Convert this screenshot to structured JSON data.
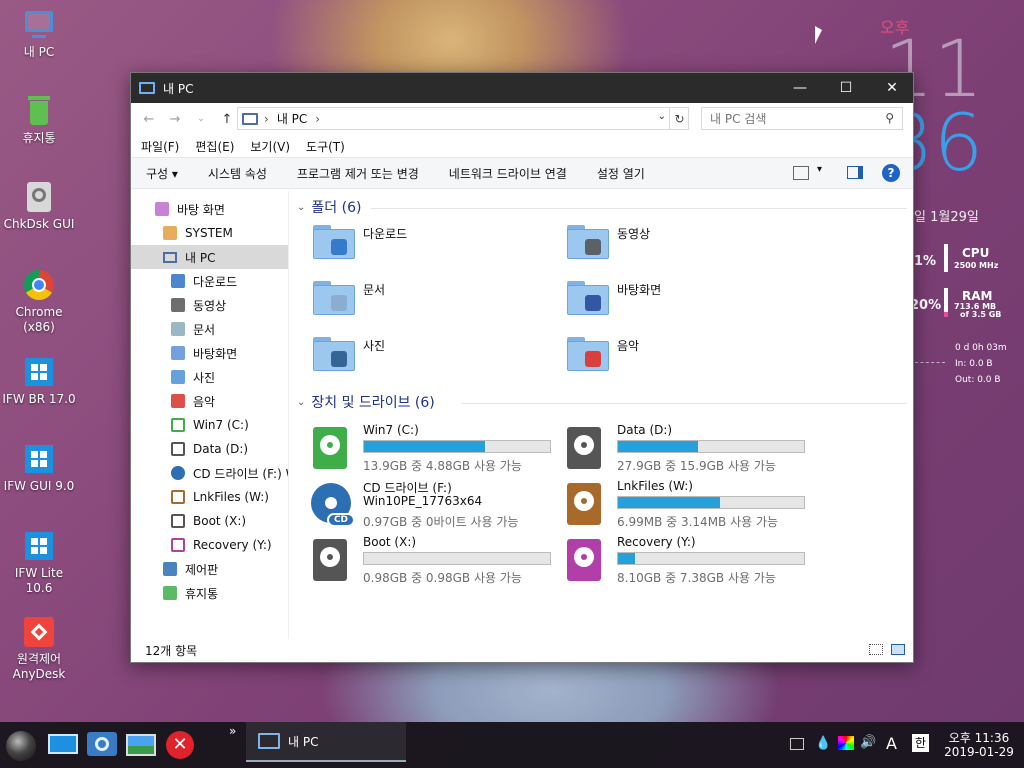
{
  "desktop": {
    "icons": [
      {
        "label": "내 PC"
      },
      {
        "label": "휴지통"
      },
      {
        "label": "ChkDsk GUI"
      },
      {
        "label": "Chrome (x86)"
      },
      {
        "label": "IFW BR 17.0"
      },
      {
        "label": "IFW GUI 9.0"
      },
      {
        "label": "IFW Lite 10.6"
      },
      {
        "label": "원격제어 AnyDesk"
      }
    ]
  },
  "widget": {
    "ampm": "오후",
    "hour": "11",
    "minute": "36",
    "date": "일 1월29일",
    "cpu_percent": "1%",
    "cpu_label": "CPU",
    "cpu_speed": "2500 MHz",
    "ram_percent": "20%",
    "ram_label": "RAM",
    "ram_used": "713.6 MB",
    "ram_of": "of  3.5 GB",
    "uptime": "0 d 0h 03m",
    "net_in": "In: 0.0 B",
    "net_out": "Out: 0.0 B"
  },
  "window": {
    "title": "내 PC",
    "controls": {
      "minimize": "—",
      "maximize": "☐",
      "close": "✕"
    },
    "address": {
      "root": "›",
      "path": "내 PC",
      "sep": "›"
    },
    "search": {
      "placeholder": "내 PC 검색"
    },
    "menu": [
      "파일(F)",
      "편집(E)",
      "보기(V)",
      "도구(T)"
    ],
    "commands": [
      "구성 ▾",
      "시스템 속성",
      "프로그램 제거 또는 변경",
      "네트워크 드라이브 연결",
      "설정 열기"
    ],
    "nav": [
      {
        "label": "바탕 화면",
        "icon": "desktop-icon",
        "indent": 0
      },
      {
        "label": "SYSTEM",
        "icon": "user-icon",
        "indent": 1
      },
      {
        "label": "내 PC",
        "icon": "pc-icon",
        "indent": 1
      },
      {
        "label": "다운로드",
        "icon": "download-icon",
        "indent": 2
      },
      {
        "label": "동영상",
        "icon": "video-icon",
        "indent": 2
      },
      {
        "label": "문서",
        "icon": "documents-icon",
        "indent": 2
      },
      {
        "label": "바탕화면",
        "icon": "desktop-folder-icon",
        "indent": 2
      },
      {
        "label": "사진",
        "icon": "pictures-icon",
        "indent": 2
      },
      {
        "label": "음악",
        "icon": "music-icon",
        "indent": 2
      },
      {
        "label": "Win7 (C:)",
        "icon": "drive-icon",
        "indent": 2
      },
      {
        "label": "Data (D:)",
        "icon": "drive-icon",
        "indent": 2
      },
      {
        "label": "CD 드라이브 (F:) W",
        "icon": "cd-icon",
        "indent": 2
      },
      {
        "label": "LnkFiles (W:)",
        "icon": "drive-icon",
        "indent": 2
      },
      {
        "label": "Boot (X:)",
        "icon": "drive-icon",
        "indent": 2
      },
      {
        "label": "Recovery (Y:)",
        "icon": "drive-icon",
        "indent": 2
      },
      {
        "label": "제어판",
        "icon": "control-panel-icon",
        "indent": 1
      },
      {
        "label": "휴지통",
        "icon": "recycle-bin-icon",
        "indent": 1
      }
    ],
    "folders_header": "폴더 (6)",
    "folders": [
      {
        "label": "다운로드",
        "icon": "download-folder-icon"
      },
      {
        "label": "동영상",
        "icon": "video-folder-icon"
      },
      {
        "label": "문서",
        "icon": "documents-folder-icon"
      },
      {
        "label": "바탕화면",
        "icon": "desktop-folder-icon"
      },
      {
        "label": "사진",
        "icon": "pictures-folder-icon"
      },
      {
        "label": "음악",
        "icon": "music-folder-icon"
      }
    ],
    "drives_header": "장치 및 드라이브 (6)",
    "drives": [
      {
        "name": "Win7 (C:)",
        "free": "13.9GB 중 4.88GB 사용 가능",
        "used_fraction": 0.65,
        "color": "#3fae49",
        "type": "hdd"
      },
      {
        "name": "Data (D:)",
        "free": "27.9GB 중 15.9GB 사용 가능",
        "used_fraction": 0.43,
        "color": "#555555",
        "type": "hdd"
      },
      {
        "name": "CD 드라이브 (F:)",
        "sub": "Win10PE_17763x64",
        "free": "0.97GB 중 0바이트 사용 가능",
        "used_fraction": null,
        "color": "#2d6fb3",
        "type": "cd"
      },
      {
        "name": "LnkFiles (W:)",
        "free": "6.99MB 중 3.14MB 사용 가능",
        "used_fraction": 0.55,
        "color": "#a86a2a",
        "type": "hdd"
      },
      {
        "name": "Boot (X:)",
        "free": "0.98GB 중 0.98GB 사용 가능",
        "used_fraction": 0.0,
        "color": "#555555",
        "type": "hdd"
      },
      {
        "name": "Recovery (Y:)",
        "free": "8.10GB 중 7.38GB 사용 가능",
        "used_fraction": 0.09,
        "color": "#b23fa8",
        "type": "hdd"
      }
    ],
    "status": "12개 항목"
  },
  "taskbar": {
    "window_button": "내 PC",
    "chevron": "»",
    "tray": {
      "ime_a": "A",
      "ime_han": "한"
    },
    "time": "오후 11:36",
    "date": "2019-01-29"
  }
}
